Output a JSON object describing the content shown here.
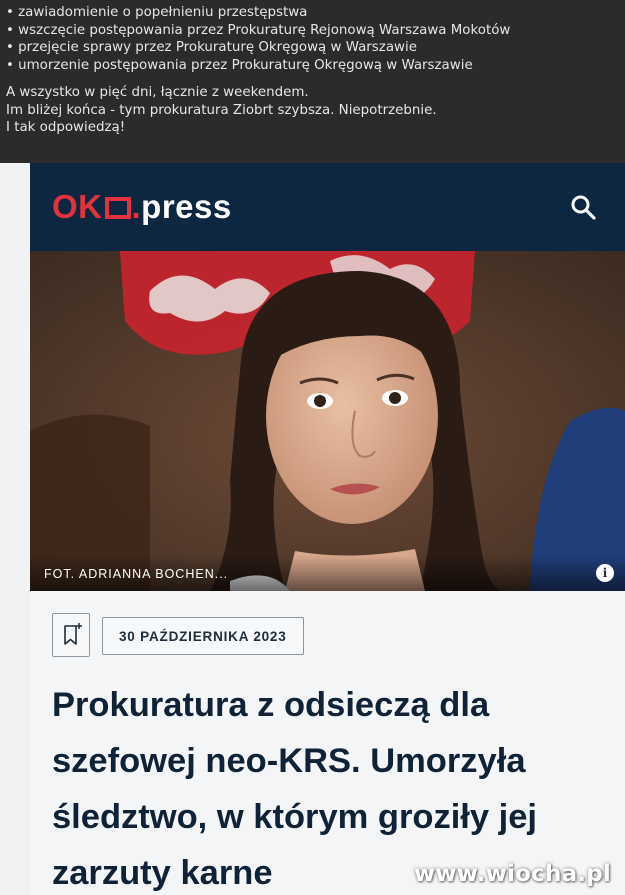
{
  "comment": {
    "bullets": [
      "zawiadomienie o popełnieniu przestępstwa",
      "wszczęcie postępowania przez Prokuraturę Rejonową Warszawa Mokotów",
      "przejęcie sprawy przez Prokuraturę Okręgową w Warszawie",
      "umorzenie postępowania przez Prokuraturę Okręgową w Warszawie"
    ],
    "lines": [
      "A wszystko w pięć dni, łącznie z weekendem.",
      "Im bliżej końca - tym prokuratura Ziobrt szybsza. Niepotrzebnie.",
      "I tak odpowiedzą!"
    ]
  },
  "header": {
    "logo_ok": "OK",
    "logo_dot": ".",
    "logo_press": "press",
    "search_icon": "search-icon"
  },
  "article": {
    "photo_credit": "FOT. ADRIANNA BOCHEN...",
    "info_icon": "info-icon",
    "info_glyph": "i",
    "bookmark_icon": "bookmark-add-icon",
    "date": "30 PAŹDZIERNIKA 2023",
    "headline": [
      "Prokuratura z odsieczą dla",
      "szefowej neo-KRS. Umorzyła",
      "śledztwo, w którym groziły jej",
      "zarzuty karne"
    ]
  },
  "watermark": "www.wiocha.pl",
  "colors": {
    "header_bg": "#0d2741",
    "brand_red": "#e2323c",
    "headline": "#0f2236",
    "comment_bg": "#2b2b2b"
  }
}
